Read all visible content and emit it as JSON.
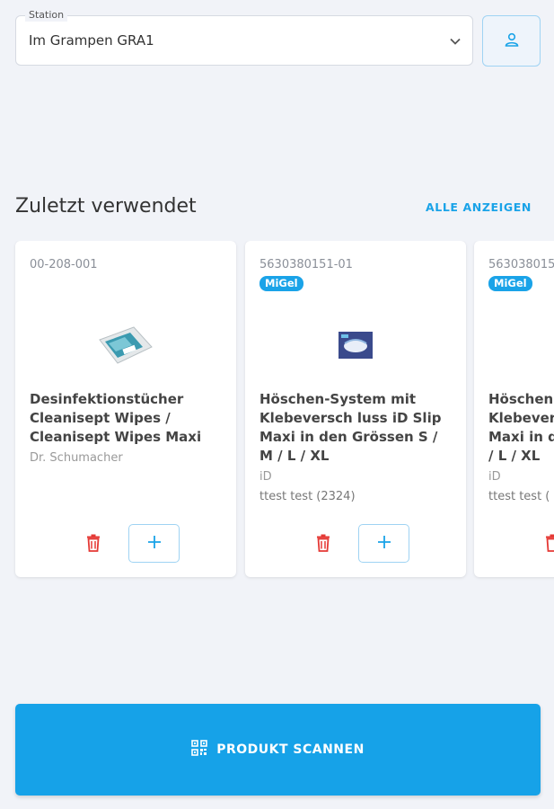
{
  "station": {
    "label": "Station",
    "value": "Im Grampen GRA1",
    "chevron_icon": "chevron-down-icon",
    "profile_icon": "user-icon"
  },
  "recent": {
    "title": "Zuletzt verwendet",
    "show_all": "ALLE ANZEIGEN",
    "items": [
      {
        "code": "00-208-001",
        "badge": "",
        "title": "Desinfektionstücher Cleanisept Wipes / Cleanisept Wipes Maxi",
        "brand": "Dr. Schumacher",
        "meta": ""
      },
      {
        "code": "5630380151-01",
        "badge": "MiGel",
        "title": "Höschen-System mit Klebeversch luss iD Slip Maxi in den Grössen S / M / L / XL",
        "brand": "iD",
        "meta": "ttest test (2324)"
      },
      {
        "code": "563038015",
        "badge": "MiGel",
        "title": "Höschen Klebever Maxi in d / L / XL",
        "brand": "iD",
        "meta": "ttest test ("
      }
    ]
  },
  "scan": {
    "label": "PRODUKT SCANNEN",
    "icon": "qr-code-icon"
  },
  "colors": {
    "accent": "#16a2e8",
    "danger": "#e53935",
    "background": "#f1f3f8"
  }
}
